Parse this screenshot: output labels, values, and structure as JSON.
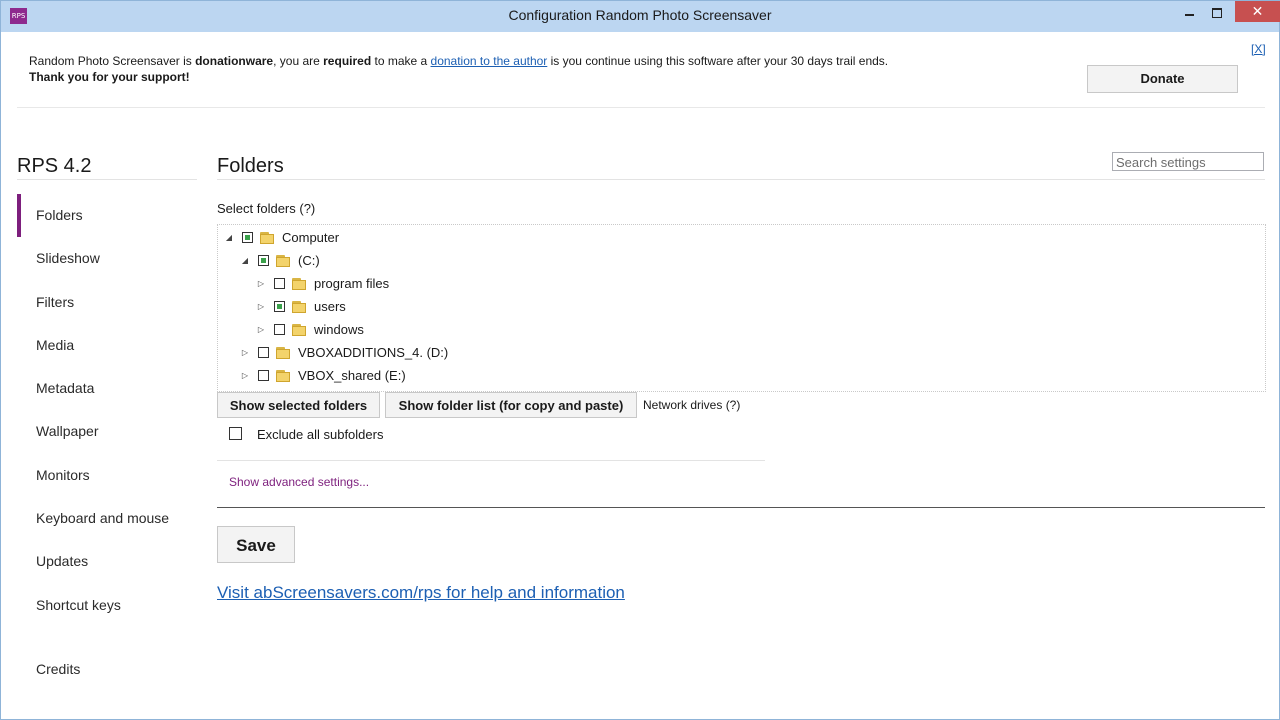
{
  "window": {
    "title": "Configuration Random Photo Screensaver",
    "icon": "RPS",
    "controls": {
      "minimize": "minimize-icon",
      "maximize": "maximize-icon",
      "close": "close-icon"
    }
  },
  "notice": {
    "text_1": "Random Photo Screensaver is ",
    "bold_1": "donationware",
    "text_2": ", you are ",
    "bold_2": "required",
    "text_3": " to make a ",
    "link": "donation to the author",
    "text_4": " is you continue using this software after your 30 days trail ends.",
    "thanks": "Thank you for your support!",
    "close": "[X]",
    "donate_button": "Donate"
  },
  "sidebar": {
    "version": "RPS 4.2",
    "items": [
      {
        "label": "Folders",
        "active": true
      },
      {
        "label": "Slideshow"
      },
      {
        "label": "Filters"
      },
      {
        "label": "Media"
      },
      {
        "label": "Metadata"
      },
      {
        "label": "Wallpaper"
      },
      {
        "label": "Monitors"
      },
      {
        "label": "Keyboard and mouse"
      },
      {
        "label": "Updates"
      },
      {
        "label": "Shortcut keys"
      }
    ],
    "credits": "Credits"
  },
  "main": {
    "title": "Folders",
    "search_placeholder": "Search settings",
    "select_label": "Select folders (?)",
    "tree": [
      {
        "label": "Computer",
        "expanded": true,
        "state": "partial"
      },
      {
        "label": "(C:)",
        "expanded": true,
        "state": "partial"
      },
      {
        "label": "program files",
        "expanded": false,
        "state": "unchecked"
      },
      {
        "label": "users",
        "expanded": false,
        "state": "partial"
      },
      {
        "label": "windows",
        "expanded": false,
        "state": "unchecked"
      },
      {
        "label": "VBOXADDITIONS_4. (D:)",
        "expanded": false,
        "state": "unchecked"
      },
      {
        "label": "VBOX_shared (E:)",
        "expanded": false,
        "state": "unchecked"
      }
    ],
    "show_selected_button": "Show selected folders",
    "show_list_button": "Show folder list (for copy and paste)",
    "network_label": "Network drives (?)",
    "exclude_label": "Exclude all subfolders",
    "exclude_checked": false,
    "advanced_link": "Show advanced settings...",
    "save_button": "Save",
    "help_link": "Visit abScreensavers.com/rps for help and information"
  },
  "colors": {
    "accent": "#7d1f7d",
    "link": "#1c5fb3",
    "titlebar": "#bcd6f1",
    "close_button": "#c75050",
    "partial_check": "#3aa14b"
  }
}
